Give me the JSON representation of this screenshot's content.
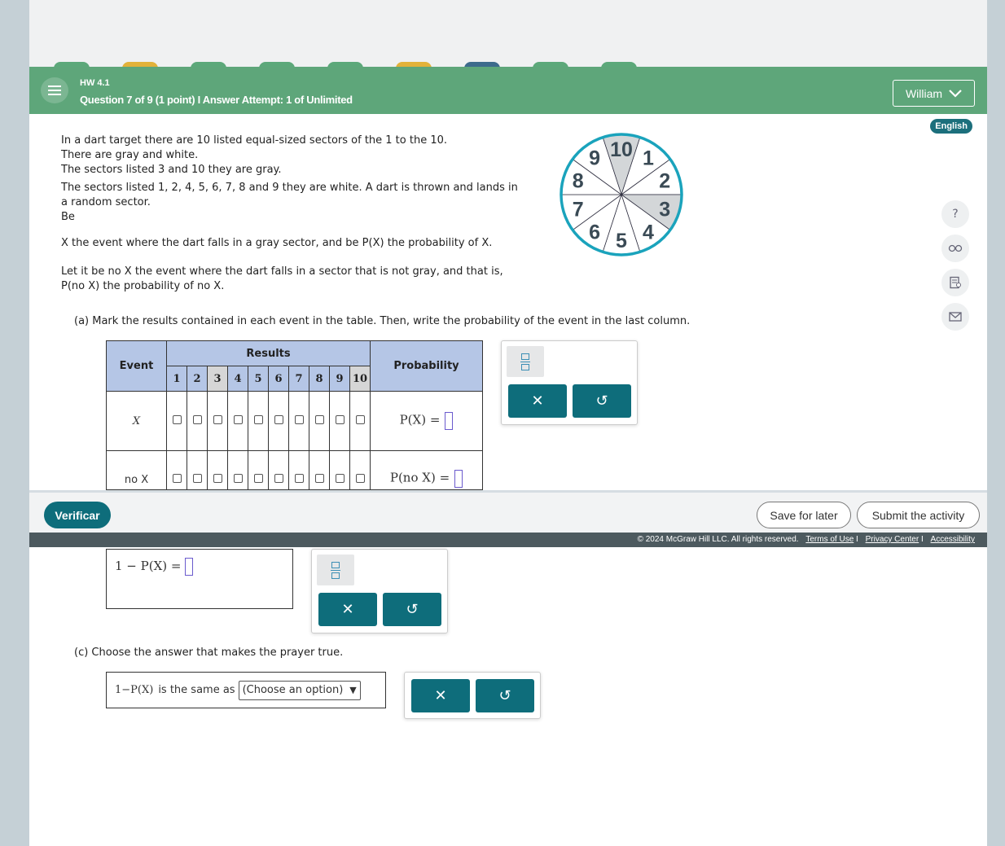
{
  "header": {
    "assignment": "HW 4.1",
    "question_info": "Question 7 of 9 (1 point)  I  Answer Attempt: 1 of Unlimited",
    "user": "William"
  },
  "language_badge": "English",
  "problem": {
    "line1": "In a dart target there are 10 listed equal-sized sectors of the 1 to the 10.",
    "line2": "There are gray and white.",
    "line3": "The sectors listed 3 and 10 they are gray.",
    "line4": "The sectors listed 1, 2, 4, 5, 6, 7, 8 and 9 they are white. A dart is thrown and lands in a random sector.",
    "line5": "Be",
    "line6": "X the event where the dart falls in a gray sector, and be P(X) the probability of X.",
    "line7": "Let it be no X the event where the dart falls in a sector that is not gray, and that is,",
    "line8": "P(no X) the probability of no X."
  },
  "dartboard": {
    "sectors": [
      "1",
      "2",
      "3",
      "4",
      "5",
      "6",
      "7",
      "8",
      "9",
      "10"
    ],
    "gray_sectors": [
      "3",
      "10"
    ],
    "ring_color": "#1aa3bc",
    "gray_color": "#d3d6d8"
  },
  "part_a": {
    "label": "(a)  Mark the results contained in each event in the table. Then, write the probability of the event in the last column.",
    "header_event": "Event",
    "header_results": "Results",
    "header_probability": "Probability",
    "results": [
      "1",
      "2",
      "3",
      "4",
      "5",
      "6",
      "7",
      "8",
      "9",
      "10"
    ],
    "rows": [
      {
        "event": "X",
        "prob": "P(X) ="
      },
      {
        "event": "no X",
        "prob": "P(no X) ="
      }
    ]
  },
  "part_b": {
    "expr": "1 − P(X) ="
  },
  "part_c": {
    "label": "(c)  Choose the answer that makes the prayer true.",
    "expr": "1−P(X)",
    "middle": "is the same as",
    "select_value": "(Choose an option)"
  },
  "footer": {
    "check_button": "Verificar",
    "save_button": "Save for later",
    "submit_button": "Submit the activity",
    "copyright": "© 2024 McGraw Hill LLC. All rights reserved.",
    "links": [
      "Terms of Use",
      "Privacy Center",
      "Accessibility"
    ]
  },
  "colors": {
    "header_green": "#5ea67a",
    "teal_button": "#0e6d7b",
    "table_header": "#b5c6e6"
  }
}
